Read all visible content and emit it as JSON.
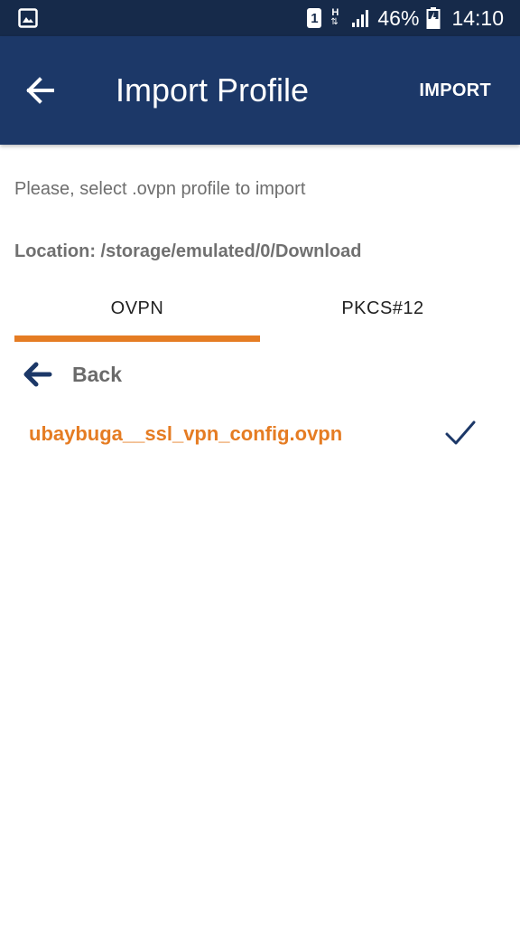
{
  "status_bar": {
    "gallery_icon": "image-icon",
    "sim_label": "1",
    "network_label": "H",
    "network_arrows": "⇅",
    "signal_icon": "signal-icon",
    "battery_percent": "46%",
    "battery_icon": "battery-charging-icon",
    "time": "14:10"
  },
  "app_bar": {
    "back_icon": "arrow-left-icon",
    "title": "Import Profile",
    "import_label": "IMPORT",
    "background_color": "#1c3868"
  },
  "content": {
    "instruction": "Please, select .ovpn profile to import",
    "location": "Location: /storage/emulated/0/Download"
  },
  "tabs": [
    {
      "label": "OVPN",
      "selected": true
    },
    {
      "label": "PKCS#12",
      "selected": false
    }
  ],
  "file_list": {
    "back_label": "Back",
    "back_icon": "arrow-left-icon",
    "items": [
      {
        "name": "ubaybuga__ssl_vpn_config.ovpn",
        "checked": true,
        "check_icon": "checkmark-icon"
      }
    ]
  },
  "colors": {
    "accent": "#e57c23",
    "status_bar": "#162a4a",
    "primary": "#1c3868"
  }
}
